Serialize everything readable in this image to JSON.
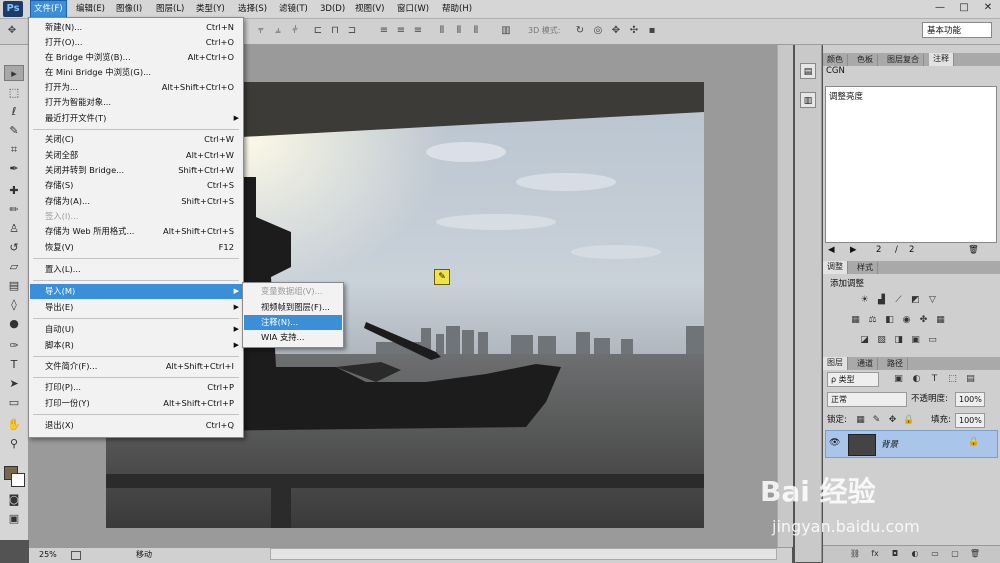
{
  "app": {
    "logo": "Ps"
  },
  "menubar": {
    "items": [
      "文件(F)",
      "编辑(E)",
      "图像(I)",
      "图层(L)",
      "类型(Y)",
      "选择(S)",
      "滤镜(T)",
      "3D(D)",
      "视图(V)",
      "窗口(W)",
      "帮助(H)"
    ],
    "window_controls": [
      "—",
      "□",
      "✕"
    ]
  },
  "options": {
    "mode3d_label": "3D 模式:",
    "workspace": "基本功能"
  },
  "file_menu": {
    "items": [
      {
        "label": "新建(N)...",
        "shortcut": "Ctrl+N"
      },
      {
        "label": "打开(O)...",
        "shortcut": "Ctrl+O"
      },
      {
        "label": "在 Bridge 中浏览(B)...",
        "shortcut": "Alt+Ctrl+O"
      },
      {
        "label": "在 Mini Bridge 中浏览(G)...",
        "shortcut": ""
      },
      {
        "label": "打开为...",
        "shortcut": "Alt+Shift+Ctrl+O"
      },
      {
        "label": "打开为智能对象...",
        "shortcut": ""
      },
      {
        "label": "最近打开文件(T)",
        "shortcut": ""
      },
      {
        "label": "关闭(C)",
        "shortcut": "Ctrl+W"
      },
      {
        "label": "关闭全部",
        "shortcut": "Alt+Ctrl+W"
      },
      {
        "label": "关闭并转到 Bridge...",
        "shortcut": "Shift+Ctrl+W"
      },
      {
        "label": "存储(S)",
        "shortcut": "Ctrl+S"
      },
      {
        "label": "存储为(A)...",
        "shortcut": "Shift+Ctrl+S"
      },
      {
        "label": "签入(I)...",
        "shortcut": ""
      },
      {
        "label": "存储为 Web 所用格式...",
        "shortcut": "Alt+Shift+Ctrl+S"
      },
      {
        "label": "恢复(V)",
        "shortcut": "F12"
      },
      {
        "label": "置入(L)...",
        "shortcut": ""
      },
      {
        "label": "导入(M)",
        "shortcut": ""
      },
      {
        "label": "导出(E)",
        "shortcut": ""
      },
      {
        "label": "自动(U)",
        "shortcut": ""
      },
      {
        "label": "脚本(R)",
        "shortcut": ""
      },
      {
        "label": "文件简介(F)...",
        "shortcut": "Alt+Shift+Ctrl+I"
      },
      {
        "label": "打印(P)...",
        "shortcut": "Ctrl+P"
      },
      {
        "label": "打印一份(Y)",
        "shortcut": "Alt+Shift+Ctrl+P"
      },
      {
        "label": "退出(X)",
        "shortcut": "Ctrl+Q"
      }
    ]
  },
  "import_submenu": {
    "items": [
      "变量数据组(V)...",
      "视频帧到图层(F)...",
      "注释(N)...",
      "WIA 支持..."
    ]
  },
  "notes_panel": {
    "tabs": [
      "颜色",
      "色板",
      "图层复合",
      "注释"
    ],
    "author": "CGN",
    "text": "调整亮度",
    "page_current": "2",
    "page_sep": "/",
    "page_total": "2"
  },
  "adjustments_panel": {
    "tabs": [
      "调整",
      "样式"
    ],
    "title": "添加调整"
  },
  "layers_panel": {
    "tabs": [
      "图层",
      "通道",
      "路径"
    ],
    "filter": "ρ 类型",
    "blend_mode": "正常",
    "opacity_label": "不透明度:",
    "opacity": "100%",
    "lock_label": "锁定:",
    "fill_label": "填充:",
    "fill": "100%",
    "layer_name": "背景"
  },
  "status": {
    "zoom": "25%",
    "tool_hint": "移动"
  },
  "watermark": {
    "brand": "Bai 经验",
    "url": "jingyan.baidu.com"
  },
  "colors": {
    "menu_highlight": "#3a8fd8",
    "layer_selected": "#a9c6ea"
  }
}
